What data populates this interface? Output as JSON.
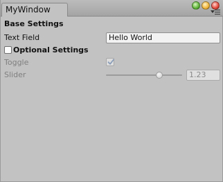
{
  "window": {
    "tab_title": "MyWindow",
    "controls": [
      "green",
      "yellow",
      "red"
    ],
    "menu_icon": "context-menu-icon"
  },
  "base_settings": {
    "heading": "Base Settings",
    "text_field_label": "Text Field",
    "text_field_value": "Hello World"
  },
  "optional_settings": {
    "label": "Optional Settings",
    "enabled": false,
    "toggle_label": "Toggle",
    "toggle_checked": true,
    "slider_label": "Slider",
    "slider_value": "1.23",
    "slider_fraction": 0.7
  }
}
